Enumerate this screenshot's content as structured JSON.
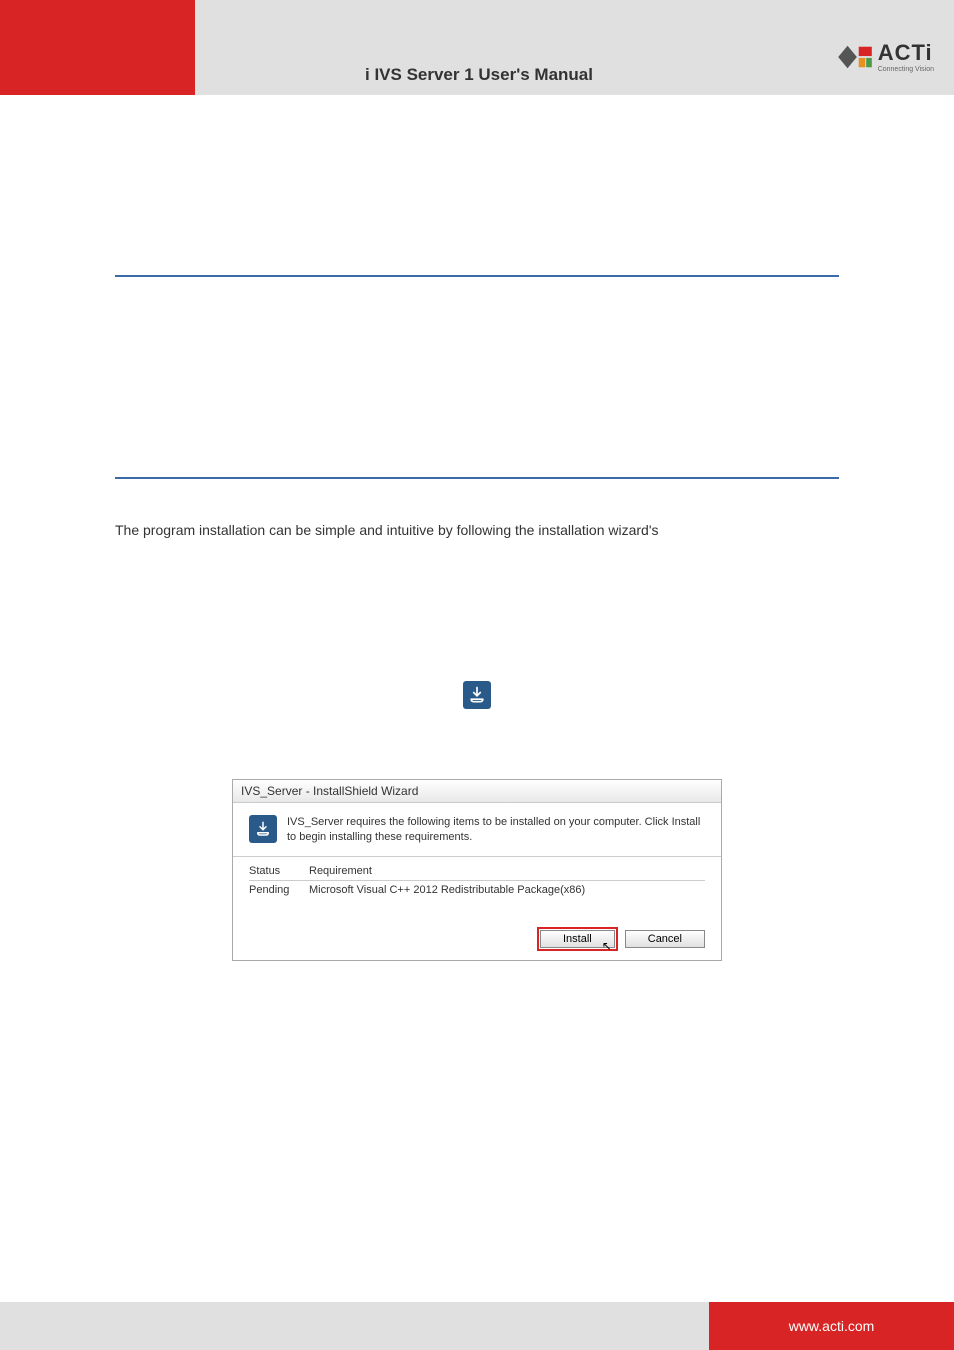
{
  "header": {
    "title": "i IVS Server 1 User's Manual",
    "logo_text": "ACTi",
    "logo_tagline": "Connecting Vision"
  },
  "content": {
    "intro": "The program installation can be simple and intuitive by following the installation wizard's"
  },
  "dialog": {
    "title": "IVS_Server - InstallShield Wizard",
    "message": "IVS_Server requires the following items to be installed on your computer. Click Install to begin installing these requirements.",
    "col_status": "Status",
    "col_requirement": "Requirement",
    "row_status": "Pending",
    "row_requirement": "Microsoft Visual C++ 2012 Redistributable Package(x86)",
    "btn_install": "Install",
    "btn_cancel": "Cancel"
  },
  "footer": {
    "url": "www.acti.com"
  }
}
